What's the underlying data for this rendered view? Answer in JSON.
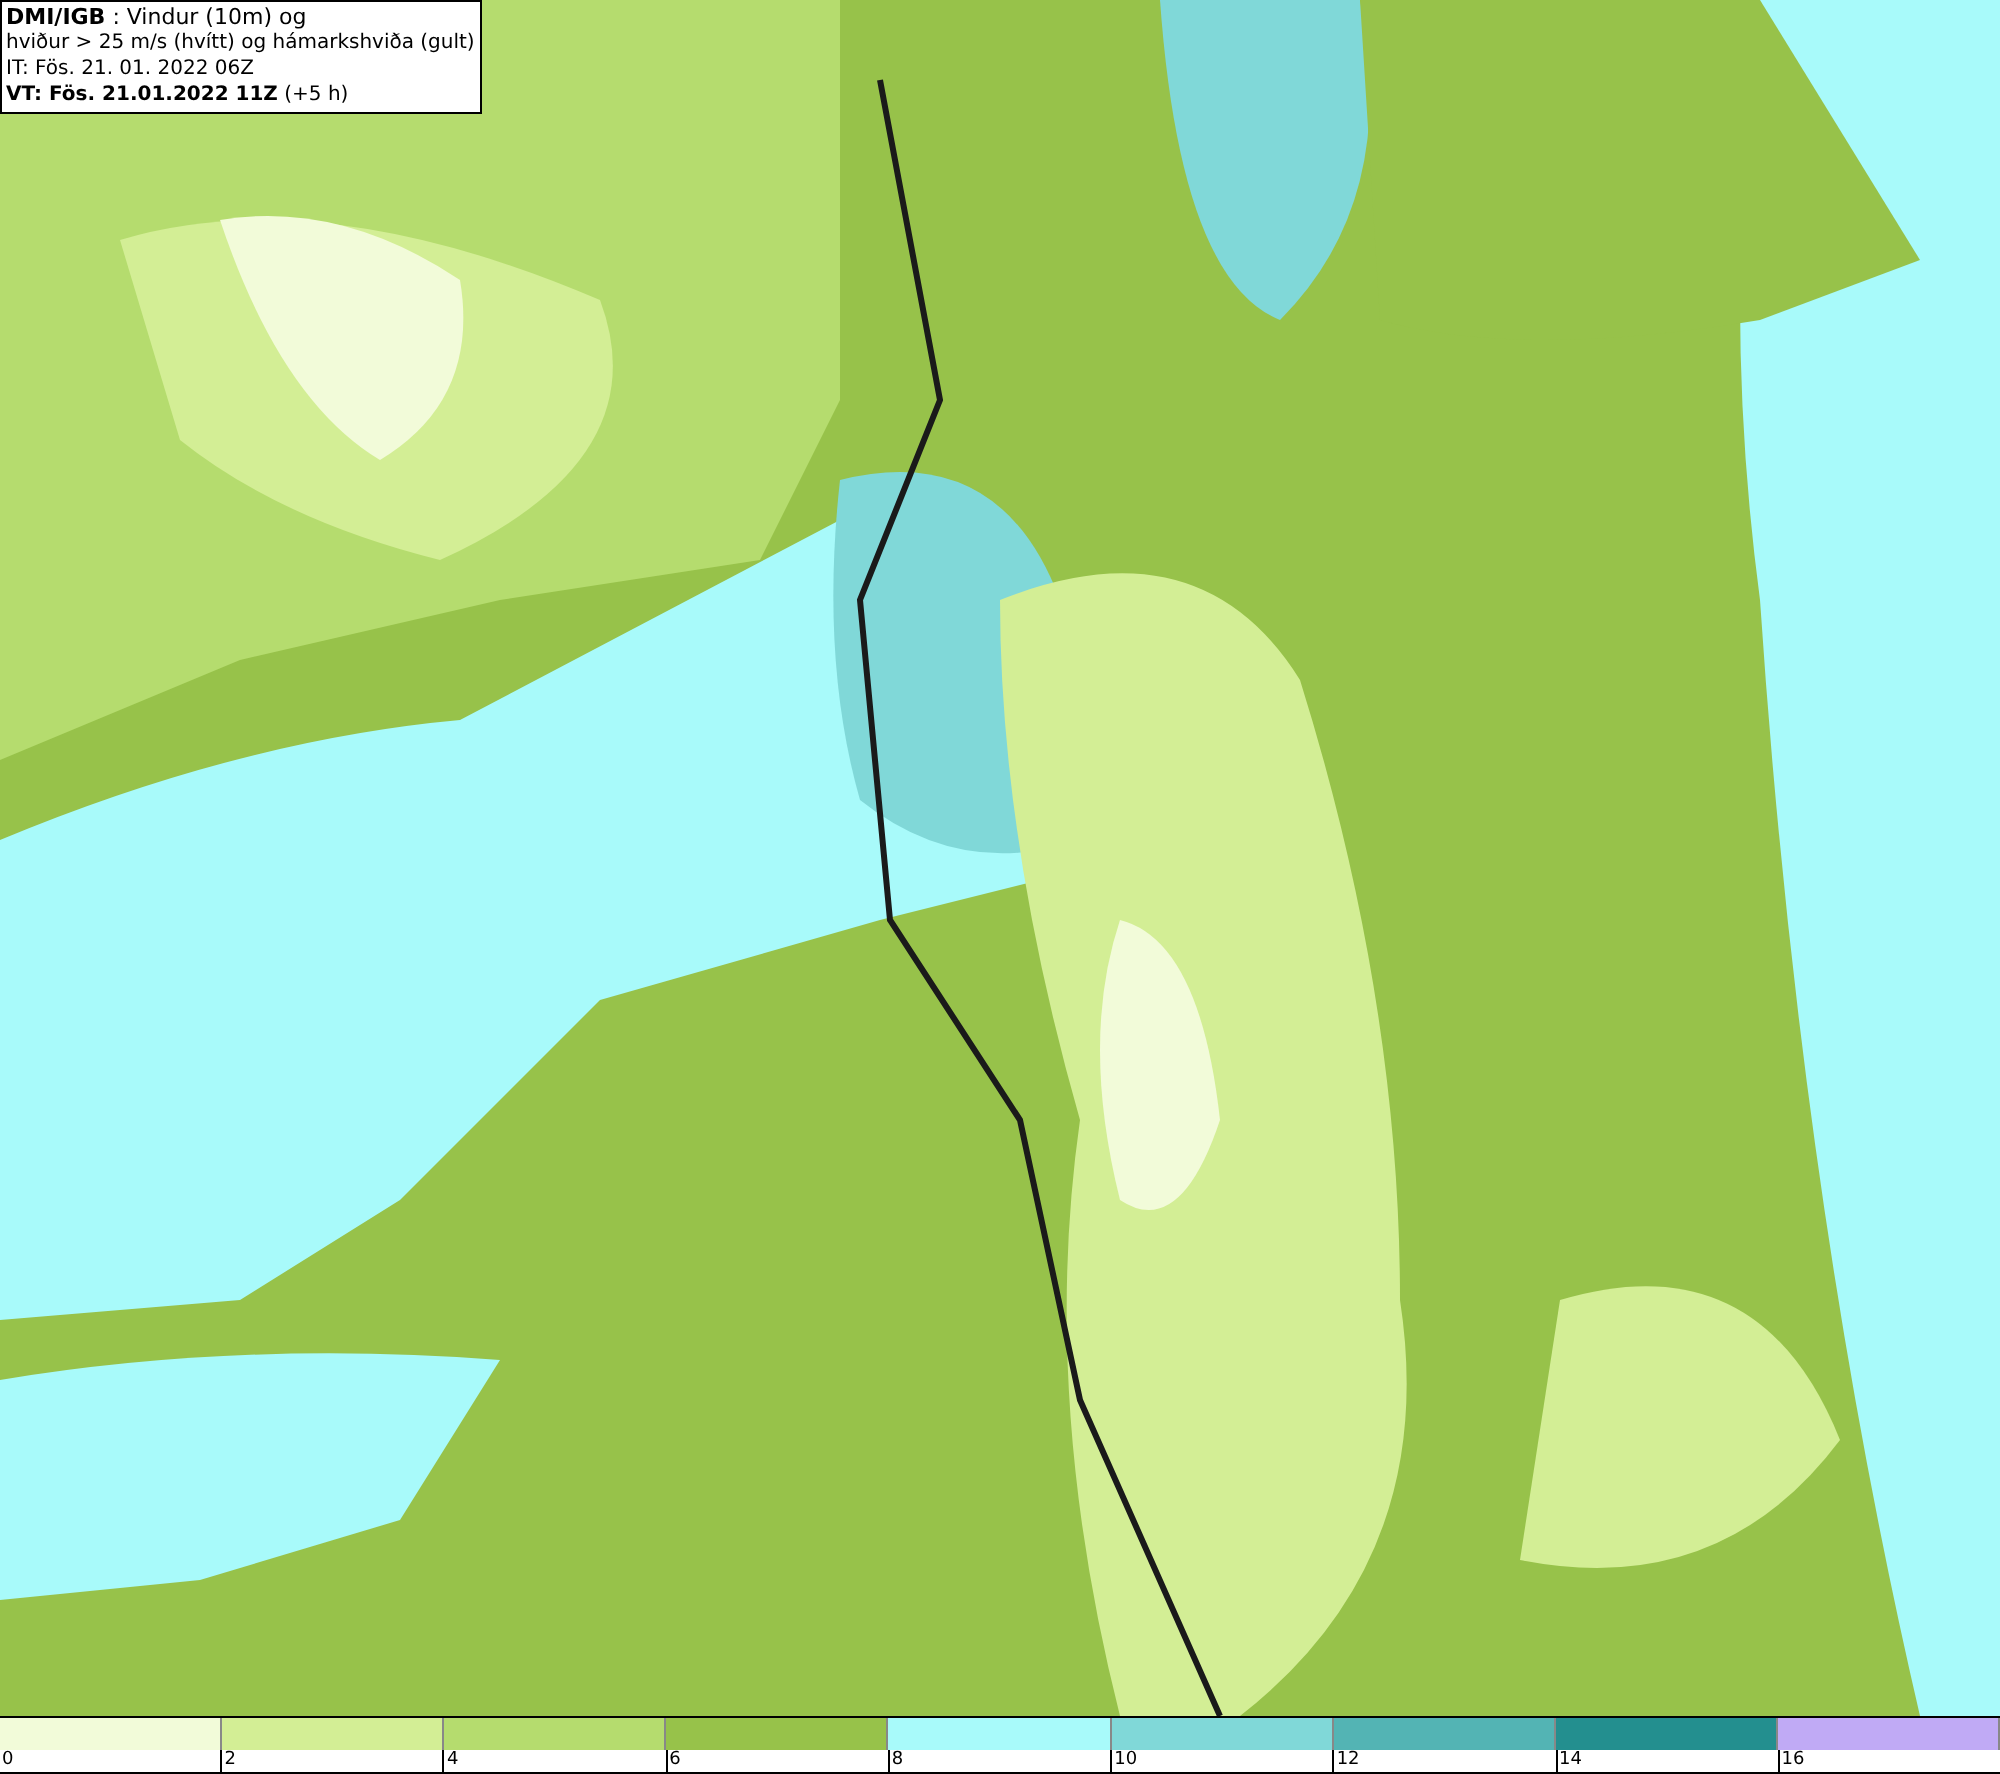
{
  "info": {
    "lines": [
      "**DMI/IGB** : Vindur (10m) og",
      "hviður > 25 m/s (hvítt) og hámarkshviða (gult)",
      "IT: Fös. 21. 01. 2022 06Z",
      "**VT: Fös. 21.01.2022 11Z** (+5 h)"
    ]
  },
  "legend": [
    {
      "color": "#f2fbd9",
      "label": "0"
    },
    {
      "color": "#d3ee95",
      "label": "2"
    },
    {
      "color": "#b5dc6e",
      "label": "4"
    },
    {
      "color": "#97c24a",
      "label": "6"
    },
    {
      "color": "#a8fafa",
      "label": "8"
    },
    {
      "color": "#80d8d8",
      "label": "10"
    },
    {
      "color": "#53b4b4",
      "label": "12"
    },
    {
      "color": "#238f8f",
      "label": "14"
    },
    {
      "color": "#c0aaf5",
      "label": "16"
    }
  ]
}
